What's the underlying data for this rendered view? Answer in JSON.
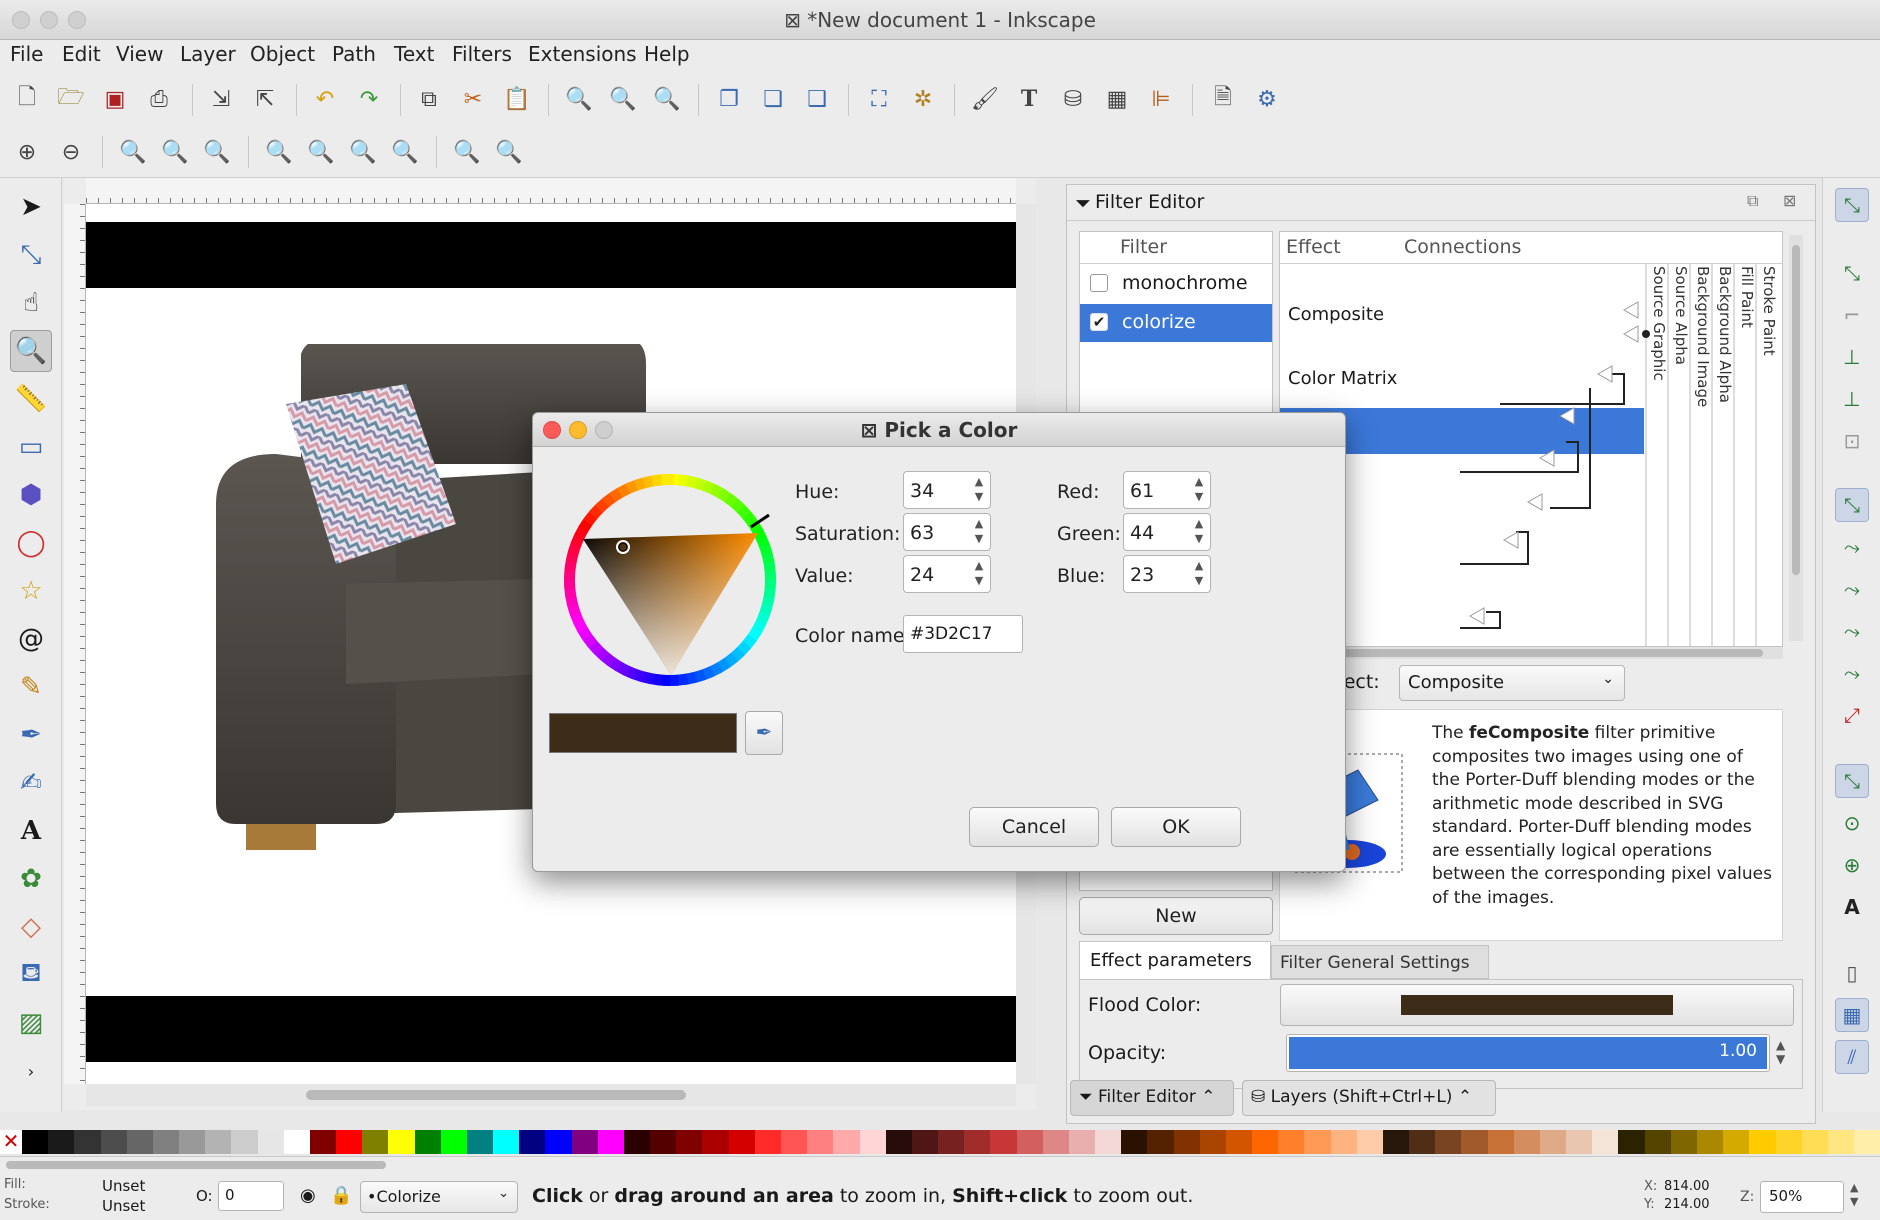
{
  "window": {
    "title": "*New document 1 - Inkscape"
  },
  "menu": [
    "File",
    "Edit",
    "View",
    "Layer",
    "Object",
    "Path",
    "Text",
    "Filters",
    "Extensions",
    "Help"
  ],
  "filter_editor": {
    "title": "Filter Editor",
    "filter_col_header": "Filter",
    "filters": [
      {
        "label": "monochrome",
        "checked": false
      },
      {
        "label": "colorize",
        "checked": true
      }
    ],
    "effect_col_header": "Effect",
    "connections_col_header": "Connections",
    "effects": [
      "Composite",
      "Color Matrix"
    ],
    "inputs": [
      "Source Graphic",
      "Source Alpha",
      "Background Image",
      "Background Alpha",
      "Fill Paint",
      "Stroke Paint"
    ],
    "add_effect_label": "fect:",
    "add_effect_value": "Composite",
    "description_bold": "feComposite",
    "description_pre": "The ",
    "description_post": " filter primitive composites two images using one of the Porter-Duff blending modes or the arithmetic mode described in SVG standard. Porter-Duff blending modes are essentially logical operations between the corresponding pixel values of the images.",
    "new_button": "New",
    "tab_params": "Effect parameters",
    "tab_general": "Filter General Settings",
    "flood_color_label": "Flood Color:",
    "flood_color": "#3d2c17",
    "opacity_label": "Opacity:",
    "opacity_value": "1.00",
    "opacity_fraction": 1.0
  },
  "dock_tabs": {
    "filter_editor": "Filter Editor",
    "layers": "Layers (Shift+Ctrl+L)"
  },
  "pick_color": {
    "title": "Pick a Color",
    "hue_label": "Hue:",
    "hue": "34",
    "saturation_label": "Saturation:",
    "saturation": "63",
    "value_label": "Value:",
    "value": "24",
    "red_label": "Red:",
    "red": "61",
    "green_label": "Green:",
    "green": "44",
    "blue_label": "Blue:",
    "blue": "23",
    "color_name_label": "Color name:",
    "color_name": "#3D2C17",
    "preview_color": "#3d2c17",
    "cancel": "Cancel",
    "ok": "OK"
  },
  "status": {
    "fill_label": "Fill:",
    "stroke_label": "Stroke:",
    "fill_value": "Unset",
    "stroke_value": "Unset",
    "opacity_label": "O:",
    "opacity_value": "0",
    "layer": "•Colorize",
    "message_parts": [
      "Click",
      " or ",
      "drag around an area",
      " to zoom in, ",
      "Shift+click",
      " to zoom out."
    ],
    "x_label": "X:",
    "x": "814.00",
    "y_label": "Y:",
    "y": "214.00",
    "z_label": "Z:",
    "zoom": "50%"
  },
  "colors": {
    "accent": "#3b78d8",
    "selected_row": "#3b78d8"
  }
}
